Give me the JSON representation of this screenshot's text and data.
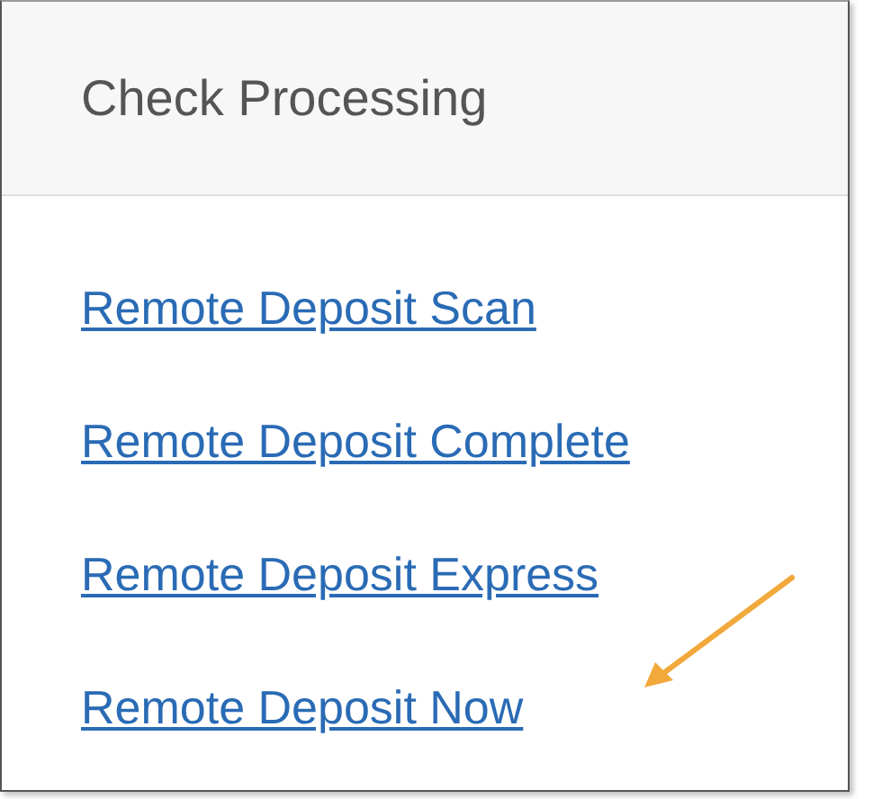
{
  "panel": {
    "title": "Check Processing"
  },
  "links": [
    {
      "label": "Remote Deposit Scan"
    },
    {
      "label": "Remote Deposit Complete"
    },
    {
      "label": "Remote Deposit Express"
    },
    {
      "label": "Remote Deposit Now"
    }
  ]
}
